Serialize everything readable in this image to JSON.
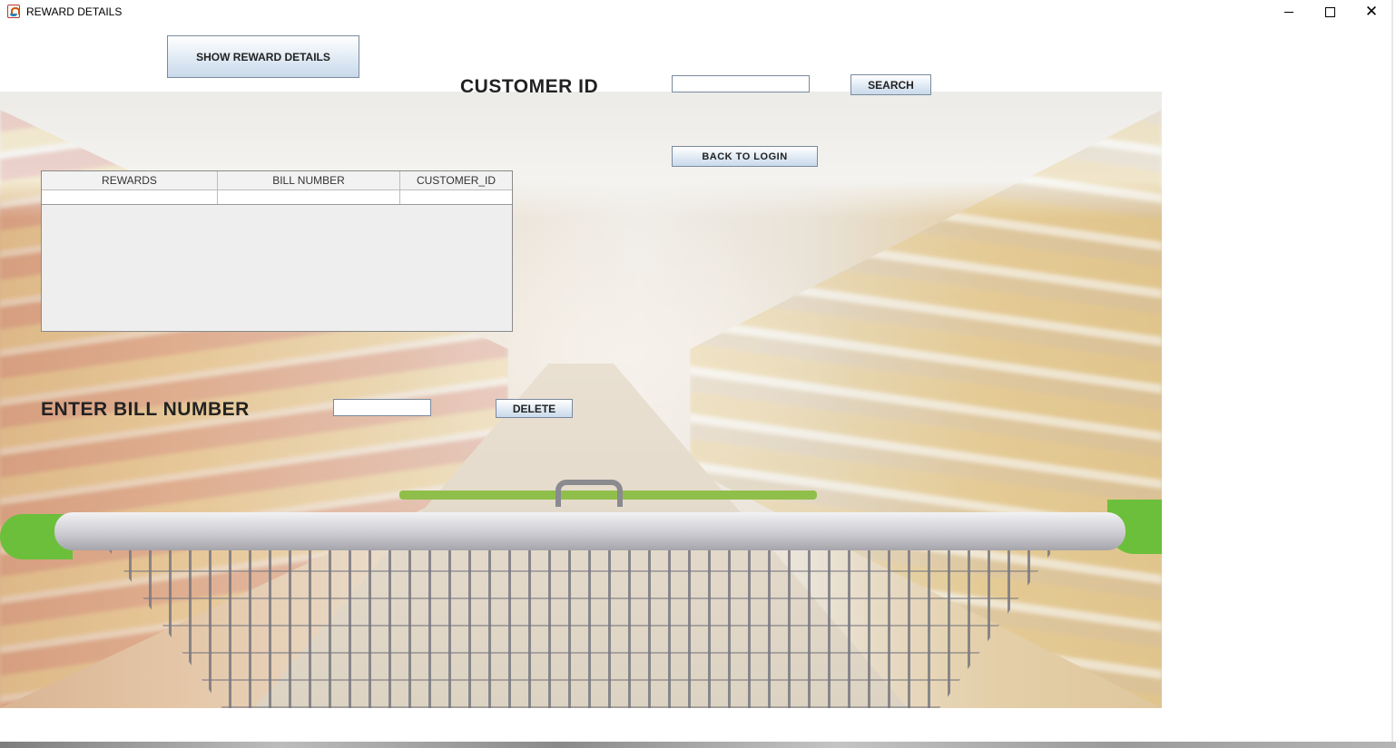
{
  "window": {
    "title": "REWARD DETAILS",
    "minimize": "—",
    "maximize": "☐",
    "close": "✕"
  },
  "toolbar": {
    "show_reward_details_label": "SHOW REWARD DETAILS"
  },
  "search": {
    "customer_id_label": "CUSTOMER ID",
    "customer_id_value": "",
    "search_label": "SEARCH"
  },
  "navigation": {
    "back_to_login_label": "BACK TO LOGIN"
  },
  "table": {
    "columns": [
      "REWARDS",
      "BILL NUMBER",
      "CUSTOMER_ID"
    ],
    "rows": [
      [
        "",
        "",
        ""
      ]
    ]
  },
  "delete": {
    "bill_number_label": "ENTER BILL NUMBER",
    "bill_number_value": "",
    "delete_label": "DELETE"
  },
  "background": {
    "image": "supermarket-aisle-with-shopping-cart"
  }
}
